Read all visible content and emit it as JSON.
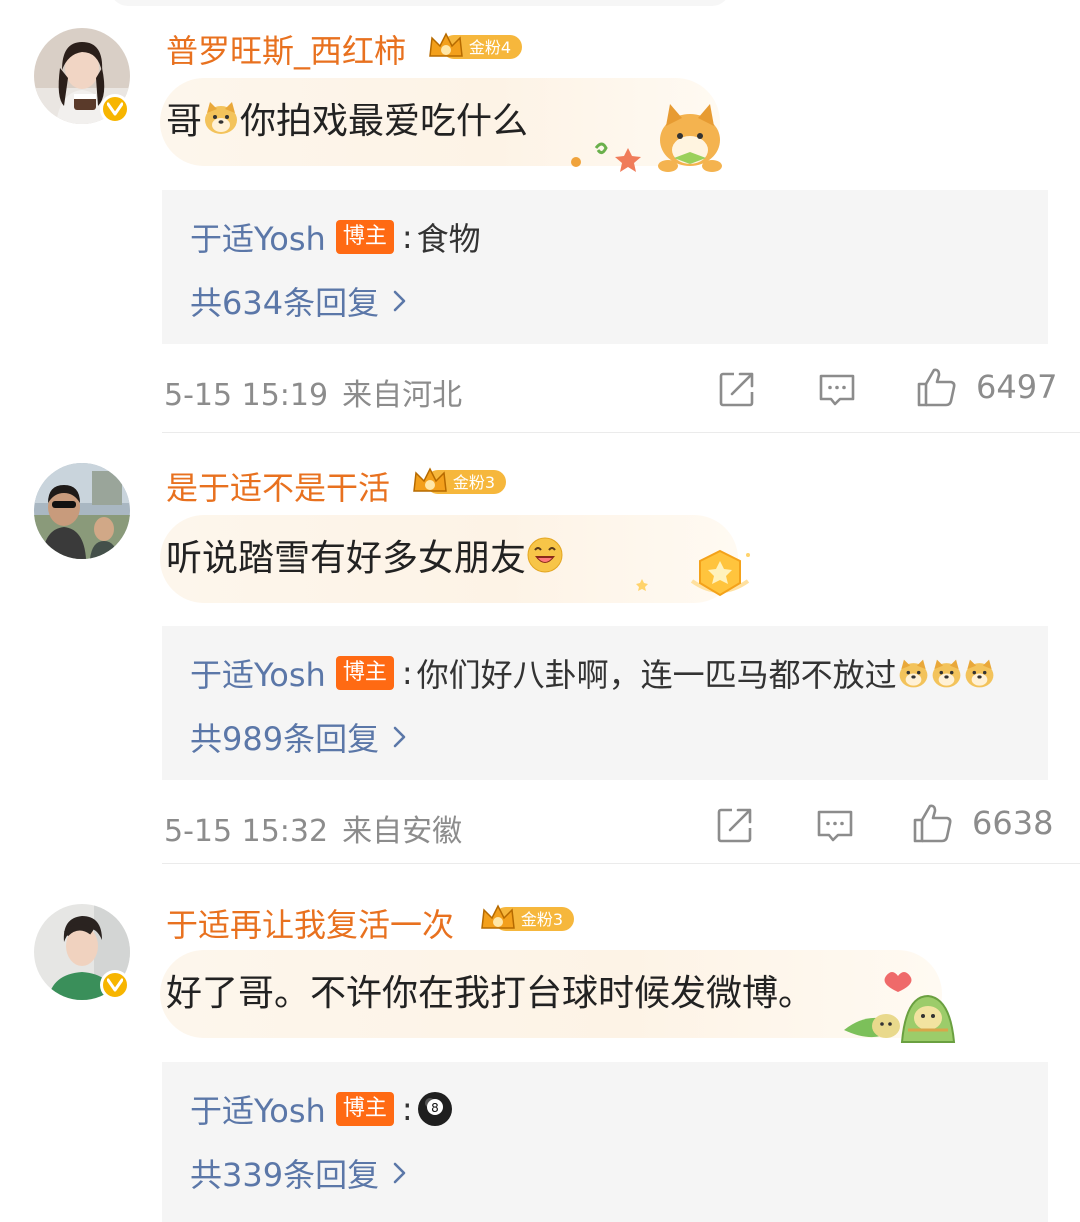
{
  "comments": [
    {
      "username": "普罗旺斯_西红柿",
      "fan_badge": "金粉4",
      "verified": true,
      "text_before": "哥",
      "text_after": "你拍戏最爱吃什么",
      "reply": {
        "author": "于适Yosh",
        "tag": "博主",
        "colon": ":",
        "text": "食物",
        "count_label": "共634条回复"
      },
      "date": "5-15 15:19",
      "location": "来自河北",
      "likes": "6497"
    },
    {
      "username": "是于适不是干活",
      "fan_badge": "金粉3",
      "verified": false,
      "text_before": "听说踏雪有好多女朋友",
      "text_after": "",
      "reply": {
        "author": "于适Yosh",
        "tag": "博主",
        "colon": ":",
        "text": "你们好八卦啊，连一匹马都不放过",
        "count_label": "共989条回复"
      },
      "date": "5-15 15:32",
      "location": "来自安徽",
      "likes": "6638"
    },
    {
      "username": "于适再让我复活一次",
      "fan_badge": "金粉3",
      "verified": true,
      "text_before": "好了哥。不许你在我打台球时候发微博。",
      "text_after": "",
      "reply": {
        "author": "于适Yosh",
        "tag": "博主",
        "colon": ":",
        "text": "",
        "count_label": "共339条回复"
      }
    }
  ],
  "colors": {
    "username": "#e8711f",
    "reply_link": "#5b77a8",
    "host_tag": "#ff6a13",
    "meta": "#8c8c8c",
    "reply_bg": "#f5f5f5"
  },
  "icons": [
    "verified-icon",
    "crown-icon",
    "doge-emoji",
    "laugh-emoji",
    "billiard-8-ball-emoji",
    "shiba-sticker",
    "star-badge-sticker",
    "zongzi-sticker",
    "share-icon",
    "comment-icon",
    "like-icon",
    "chevron-right-icon"
  ]
}
